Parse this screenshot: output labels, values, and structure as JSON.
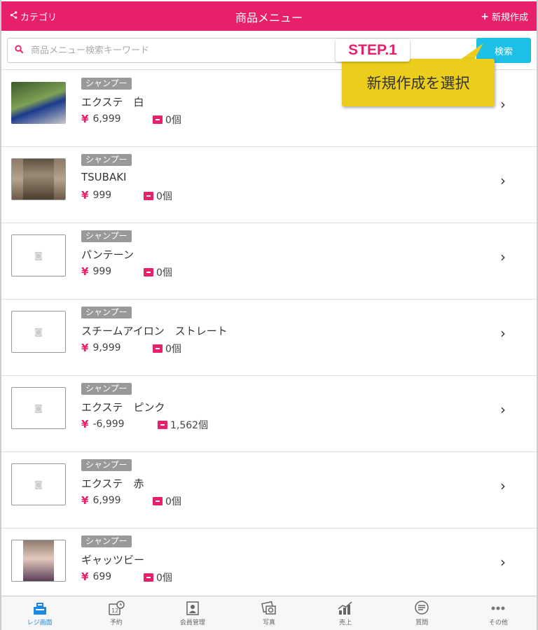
{
  "header": {
    "category_label": "カテゴリ",
    "title": "商品メニュー",
    "new_label": "新規作成",
    "bg_color": "#e8206b"
  },
  "search": {
    "placeholder": "商品メニュー検索キーワード",
    "value": "",
    "button_label": "検索"
  },
  "annotation": {
    "step": "STEP.1",
    "text": "新規作成を選択"
  },
  "items": [
    {
      "tag": "シャンプー",
      "name": "エクステ　白",
      "price": "6,999",
      "stock": "0個",
      "photo": true
    },
    {
      "tag": "シャンプー",
      "name": "TSUBAKI",
      "price": "999",
      "stock": "0個",
      "photo": true
    },
    {
      "tag": "シャンプー",
      "name": "パンテーン",
      "price": "999",
      "stock": "0個",
      "photo": false
    },
    {
      "tag": "シャンプー",
      "name": "スチームアイロン　ストレート",
      "price": "9,999",
      "stock": "0個",
      "photo": false
    },
    {
      "tag": "シャンプー",
      "name": "エクステ　ピンク",
      "price": "-6,999",
      "stock": "1,562個",
      "photo": false
    },
    {
      "tag": "シャンプー",
      "name": "エクステ　赤",
      "price": "6,999",
      "stock": "0個",
      "photo": false
    },
    {
      "tag": "シャンプー",
      "name": "ギャッツビー",
      "price": "699",
      "stock": "0個",
      "photo": true
    }
  ],
  "currency_symbol": "¥",
  "tabbar": [
    {
      "label": "レジ画面",
      "icon": "register-icon",
      "active": true
    },
    {
      "label": "予約",
      "icon": "calendar-icon",
      "active": false
    },
    {
      "label": "会員管理",
      "icon": "member-icon",
      "active": false
    },
    {
      "label": "写真",
      "icon": "photo-icon",
      "active": false
    },
    {
      "label": "売上",
      "icon": "chart-icon",
      "active": false
    },
    {
      "label": "質問",
      "icon": "chat-icon",
      "active": false
    },
    {
      "label": "その他",
      "icon": "more-icon",
      "active": false
    }
  ]
}
